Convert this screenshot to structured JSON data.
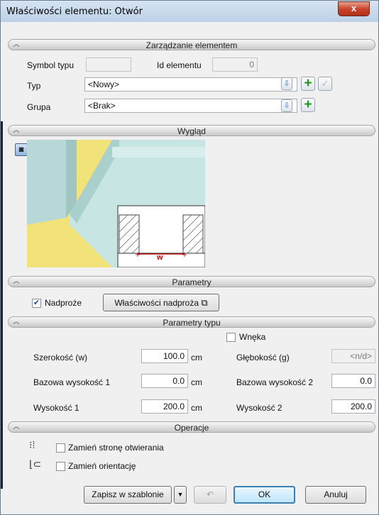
{
  "window": {
    "title": "Właściwości elementu: Otwór",
    "close_label": "x"
  },
  "sections": {
    "management": "Zarządzanie elementem",
    "appearance": "Wygląd",
    "parameters": "Parametry",
    "type_parameters": "Parametry typu",
    "operations": "Operacje"
  },
  "management": {
    "symbol_label": "Symbol typu",
    "symbol_value": "",
    "id_label": "Id elementu",
    "id_value": "0",
    "type_label": "Typ",
    "type_value": "<Nowy>",
    "group_label": "Grupa",
    "group_value": "<Brak>"
  },
  "appearance": {
    "dimension_label": "w"
  },
  "parameters": {
    "lintel_label": "Nadproże",
    "lintel_checked": true,
    "lintel_props_button": "Właściwości nadproża"
  },
  "type_params": {
    "niche_label": "Wnęka",
    "niche_checked": false,
    "width_label": "Szerokość (w)",
    "width_value": "100.0",
    "width_unit": "cm",
    "depth_label": "Głębokość (g)",
    "depth_value": "<n/d>",
    "base_h1_label": "Bazowa wysokość 1",
    "base_h1_value": "0.0",
    "base_h1_unit": "cm",
    "base_h2_label": "Bazowa wysokość 2",
    "base_h2_value": "0.0",
    "height1_label": "Wysokość 1",
    "height1_value": "200.0",
    "height1_unit": "cm",
    "height2_label": "Wysokość 2",
    "height2_value": "200.0"
  },
  "operations": {
    "swap_side_label": "Zamień stronę otwierania",
    "swap_orientation_label": "Zamień orientację"
  },
  "footer": {
    "save_template_label": "Zapisz w szablonie",
    "ok_label": "OK",
    "cancel_label": "Anuluj"
  }
}
